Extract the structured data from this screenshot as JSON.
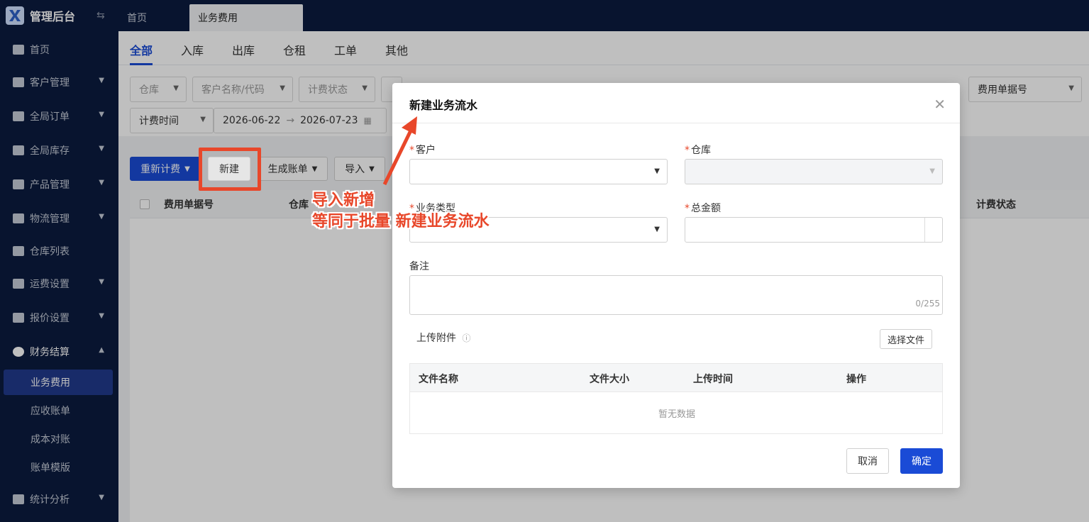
{
  "app": {
    "title": "管理后台"
  },
  "top_tabs": [
    {
      "label": "首页"
    },
    {
      "label": "业务费用"
    }
  ],
  "sidebar": {
    "items": [
      {
        "label": "首页",
        "icon": "home-icon"
      },
      {
        "label": "客户管理",
        "icon": "users-icon"
      },
      {
        "label": "全局订单",
        "icon": "order-icon"
      },
      {
        "label": "全局库存",
        "icon": "warehouse-icon"
      },
      {
        "label": "产品管理",
        "icon": "box-icon"
      },
      {
        "label": "物流管理",
        "icon": "truck-icon"
      },
      {
        "label": "仓库列表",
        "icon": "building-icon"
      },
      {
        "label": "运费设置",
        "icon": "shipping-icon"
      },
      {
        "label": "报价设置",
        "icon": "quote-icon"
      },
      {
        "label": "财务结算",
        "icon": "finance-icon"
      },
      {
        "label": "统计分析",
        "icon": "chart-icon"
      }
    ],
    "sub_items": [
      {
        "label": "业务费用"
      },
      {
        "label": "应收账单"
      },
      {
        "label": "成本对账"
      },
      {
        "label": "账单模版"
      }
    ]
  },
  "sub_tabs": [
    {
      "label": "全部"
    },
    {
      "label": "入库"
    },
    {
      "label": "出库"
    },
    {
      "label": "仓租"
    },
    {
      "label": "工单"
    },
    {
      "label": "其他"
    }
  ],
  "filters": {
    "warehouse": "仓库",
    "customer": "客户名称/代码",
    "billing_status": "计费状态",
    "fee_no": "费用单据号",
    "time_type": "计费时间",
    "date_start": "2026-06-22",
    "date_end": "2026-07-23"
  },
  "toolbar": {
    "recalc": "重新计费",
    "new": "新建",
    "gen_bill": "生成账单",
    "import": "导入"
  },
  "table": {
    "headers": [
      "费用单据号",
      "仓库",
      "计费状态"
    ]
  },
  "annotation": {
    "line1": "导入新增",
    "line2": "等同于批量 新建业务流水"
  },
  "modal": {
    "title": "新建业务流水",
    "customer_label": "客户",
    "warehouse_label": "仓库",
    "biz_type_label": "业务类型",
    "total_label": "总金额",
    "remark_label": "备注",
    "counter": "0/255",
    "upload_label": "上传附件",
    "choose_file": "选择文件",
    "file_headers": [
      "文件名称",
      "文件大小",
      "上传时间",
      "操作"
    ],
    "empty": "暂无数据",
    "cancel": "取消",
    "confirm": "确定"
  },
  "colors": {
    "primary": "#1a4bd6",
    "sidebar_bg": "#0b1b3f",
    "annotation": "#e8472a"
  }
}
